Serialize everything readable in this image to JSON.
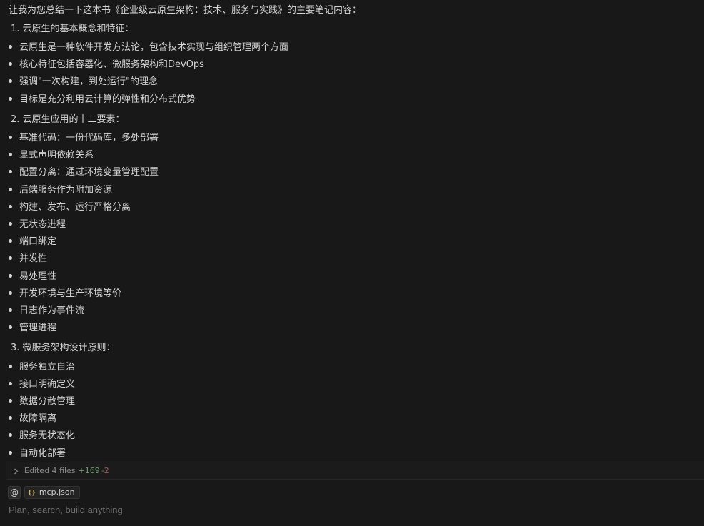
{
  "chat": {
    "intro": "让我为您总结一下这本书《企业级云原生架构：技术、服务与实践》的主要笔记内容：",
    "sections": [
      {
        "heading": "1. 云原生的基本概念和特征：",
        "items": [
          "云原生是一种软件开发方法论，包含技术实现与组织管理两个方面",
          "核心特征包括容器化、微服务架构和DevOps",
          "强调\"一次构建，到处运行\"的理念",
          "目标是充分利用云计算的弹性和分布式优势"
        ]
      },
      {
        "heading": "2. 云原生应用的十二要素：",
        "items": [
          "基准代码：一份代码库，多处部署",
          "显式声明依赖关系",
          "配置分离：通过环境变量管理配置",
          "后端服务作为附加资源",
          "构建、发布、运行严格分离",
          "无状态进程",
          "端口绑定",
          "并发性",
          "易处理性",
          "开发环境与生产环境等价",
          "日志作为事件流",
          "管理进程"
        ]
      },
      {
        "heading": "3. 微服务架构设计原则：",
        "items": [
          "服务独立自治",
          "接口明确定义",
          "数据分散管理",
          "故障隔离",
          "服务无状态化",
          "自动化部署"
        ]
      }
    ]
  },
  "edited_bar": {
    "label": "Edited 4 files",
    "added": "+169",
    "removed": "-2"
  },
  "composer": {
    "at_symbol": "@",
    "context_chip": "mcp.json",
    "placeholder": "Plan, search, build anything"
  }
}
